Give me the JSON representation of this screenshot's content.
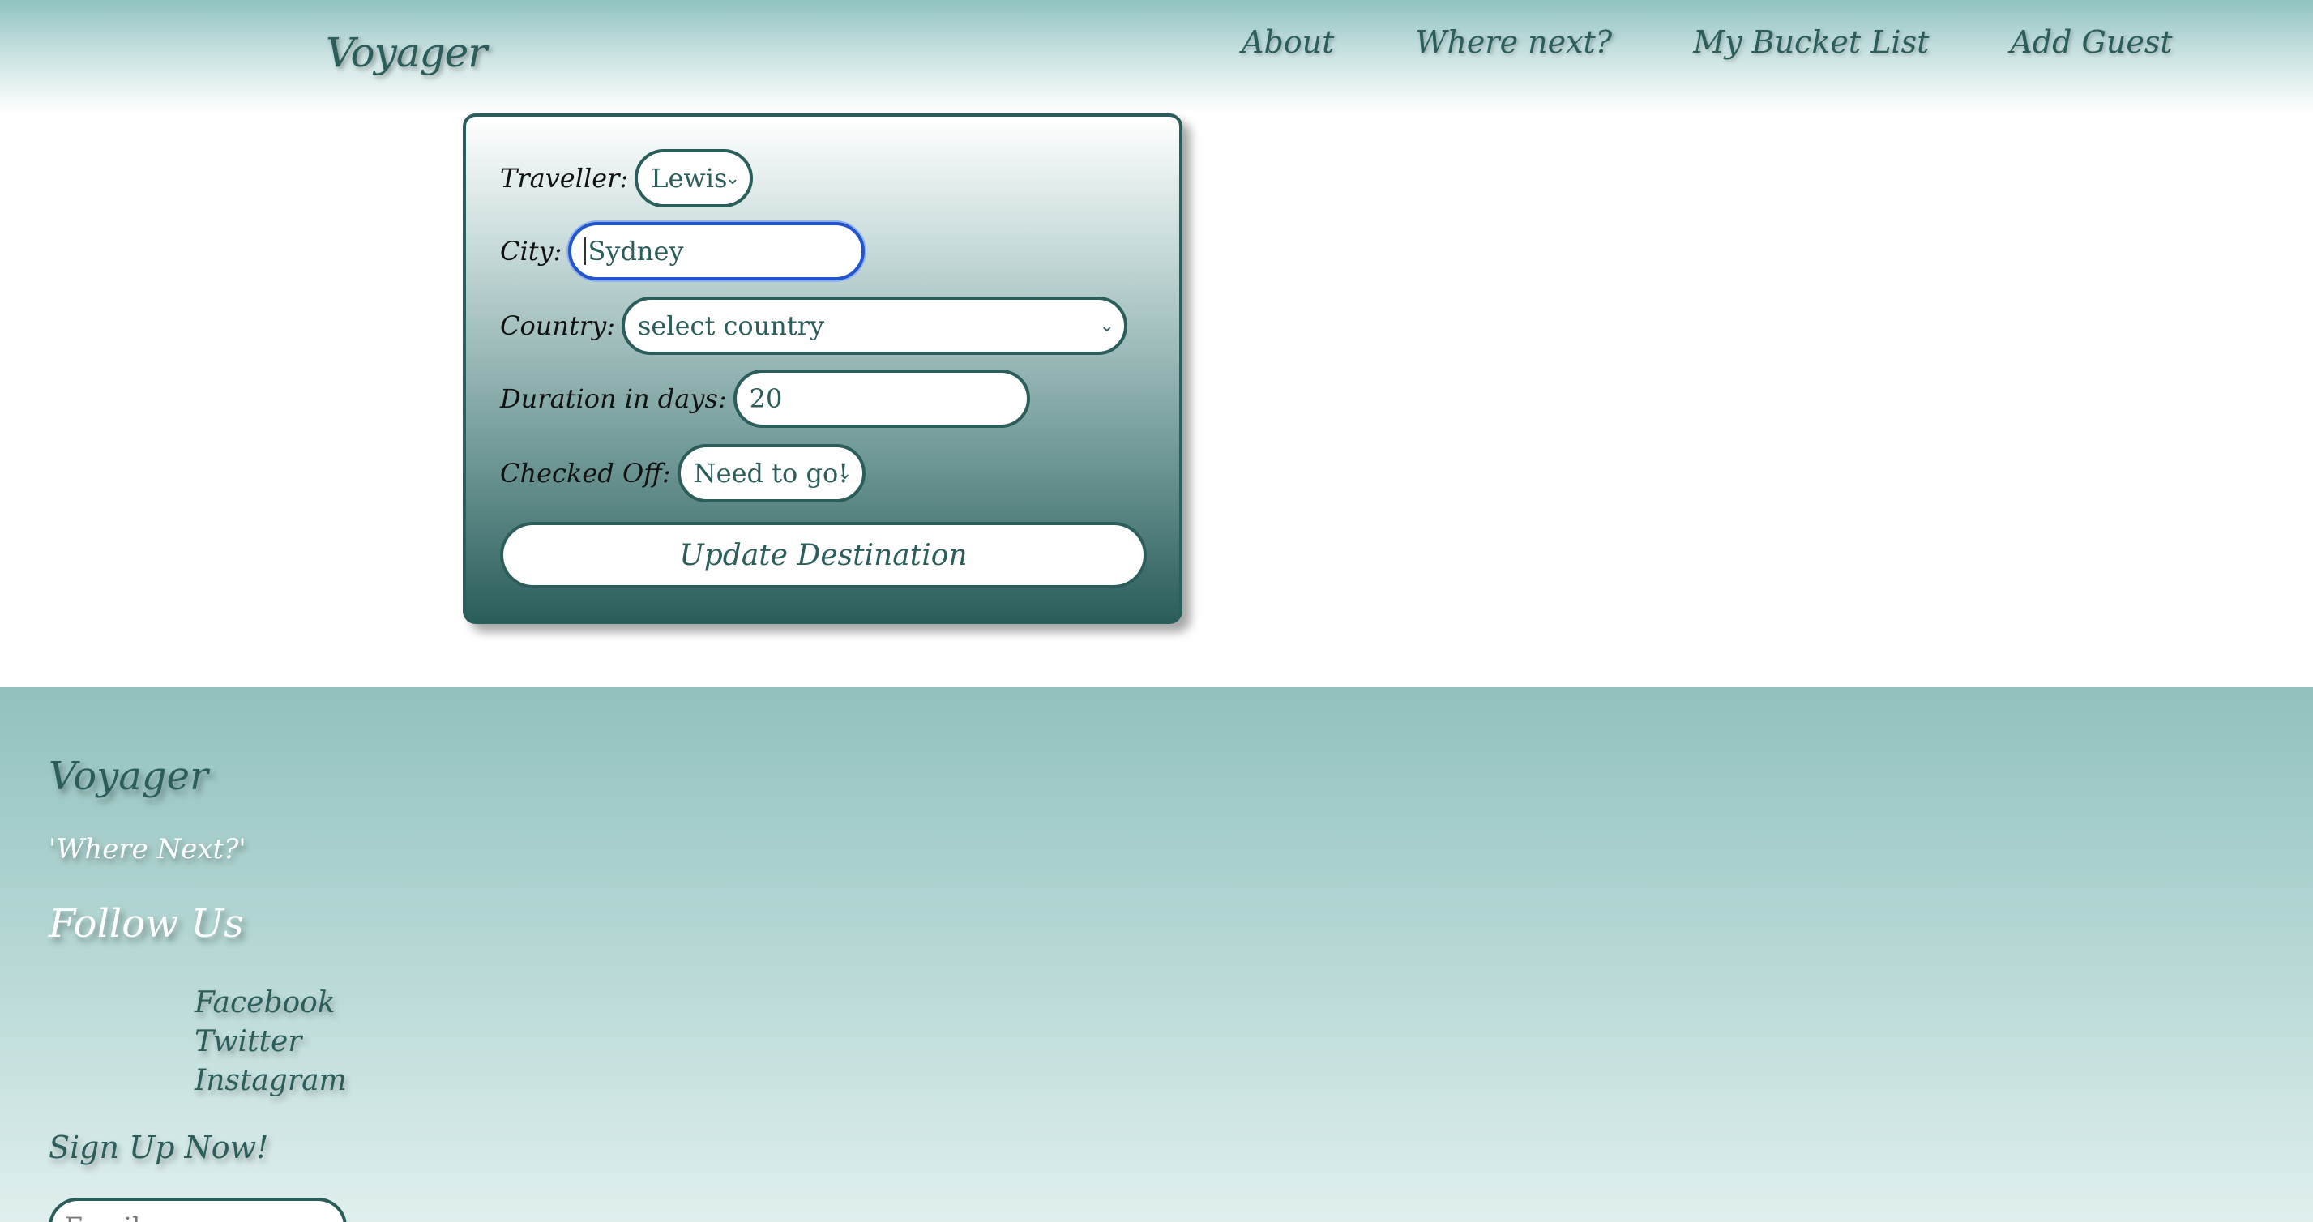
{
  "header": {
    "brand": "Voyager",
    "nav": [
      "About",
      "Where next?",
      "My Bucket List",
      "Add Guest"
    ]
  },
  "form": {
    "traveller_label": "Traveller:",
    "traveller_value": "Lewis",
    "city_label": "City:",
    "city_value": "Sydney",
    "country_label": "Country:",
    "country_value": "select country",
    "duration_label": "Duration in days:",
    "duration_value": "20",
    "checked_label": "Checked Off:",
    "checked_value": "Need to go!",
    "submit_label": "Update Destination"
  },
  "footer": {
    "brand": "Voyager",
    "tagline": "'Where Next?'",
    "follow_title": "Follow Us",
    "social": [
      "Facebook",
      "Twitter",
      "Instagram"
    ],
    "signup_title": "Sign Up Now!",
    "email_placeholder": "Email"
  },
  "colors": {
    "primary": "#2b5e5b",
    "header_top": "#8fc2c0",
    "footer_top": "#92c1bd",
    "focus": "#2255cc"
  },
  "icons": {
    "select_chevron": "chevron-down-icon"
  }
}
